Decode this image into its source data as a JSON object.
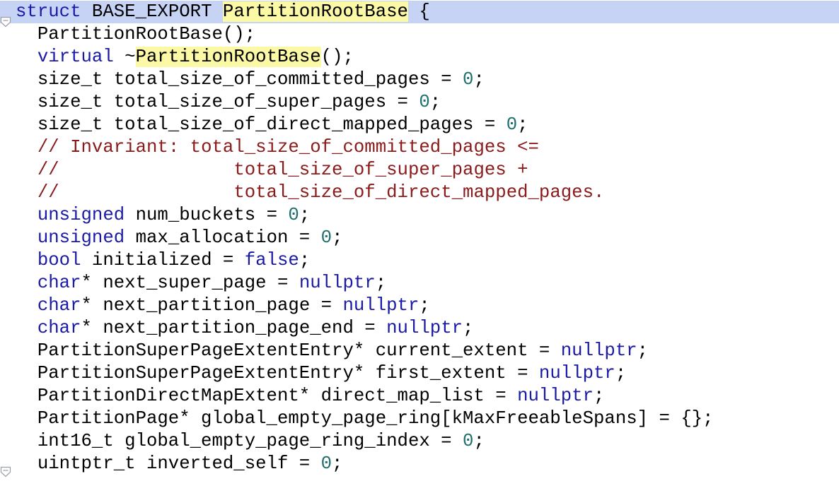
{
  "editor": {
    "colors": {
      "keyword": "#1a1aa6",
      "number": "#1f6f6f",
      "comment": "#8b1a1a",
      "identifier_highlight": "#fbf8a6",
      "current_line": "#c6d3f5"
    },
    "fold_markers": [
      "fold-open-icon",
      "fold-close-icon"
    ],
    "lines": [
      [
        {
          "t": "kw",
          "v": "struct"
        },
        {
          "t": "",
          "v": " BASE_EXPORT "
        },
        {
          "t": "hl",
          "v": "PartitionRootBase"
        },
        {
          "t": "",
          "v": " {"
        }
      ],
      [
        {
          "t": "",
          "v": "  PartitionRootBase();"
        }
      ],
      [
        {
          "t": "",
          "v": "  "
        },
        {
          "t": "kw",
          "v": "virtual"
        },
        {
          "t": "",
          "v": " ~"
        },
        {
          "t": "hl",
          "v": "PartitionRootBase"
        },
        {
          "t": "",
          "v": "();"
        }
      ],
      [
        {
          "t": "",
          "v": "  size_t total_size_of_committed_pages = "
        },
        {
          "t": "num",
          "v": "0"
        },
        {
          "t": "",
          "v": ";"
        }
      ],
      [
        {
          "t": "",
          "v": "  size_t total_size_of_super_pages = "
        },
        {
          "t": "num",
          "v": "0"
        },
        {
          "t": "",
          "v": ";"
        }
      ],
      [
        {
          "t": "",
          "v": "  size_t total_size_of_direct_mapped_pages = "
        },
        {
          "t": "num",
          "v": "0"
        },
        {
          "t": "",
          "v": ";"
        }
      ],
      [
        {
          "t": "",
          "v": "  "
        },
        {
          "t": "cmt",
          "v": "// Invariant: total_size_of_committed_pages <="
        }
      ],
      [
        {
          "t": "",
          "v": "  "
        },
        {
          "t": "cmt",
          "v": "//                total_size_of_super_pages +"
        }
      ],
      [
        {
          "t": "",
          "v": "  "
        },
        {
          "t": "cmt",
          "v": "//                total_size_of_direct_mapped_pages."
        }
      ],
      [
        {
          "t": "",
          "v": "  "
        },
        {
          "t": "kw",
          "v": "unsigned"
        },
        {
          "t": "",
          "v": " num_buckets = "
        },
        {
          "t": "num",
          "v": "0"
        },
        {
          "t": "",
          "v": ";"
        }
      ],
      [
        {
          "t": "",
          "v": "  "
        },
        {
          "t": "kw",
          "v": "unsigned"
        },
        {
          "t": "",
          "v": " max_allocation = "
        },
        {
          "t": "num",
          "v": "0"
        },
        {
          "t": "",
          "v": ";"
        }
      ],
      [
        {
          "t": "",
          "v": "  "
        },
        {
          "t": "kw",
          "v": "bool"
        },
        {
          "t": "",
          "v": " initialized = "
        },
        {
          "t": "kw",
          "v": "false"
        },
        {
          "t": "",
          "v": ";"
        }
      ],
      [
        {
          "t": "",
          "v": "  "
        },
        {
          "t": "kw",
          "v": "char"
        },
        {
          "t": "",
          "v": "* next_super_page = "
        },
        {
          "t": "kw",
          "v": "nullptr"
        },
        {
          "t": "",
          "v": ";"
        }
      ],
      [
        {
          "t": "",
          "v": "  "
        },
        {
          "t": "kw",
          "v": "char"
        },
        {
          "t": "",
          "v": "* next_partition_page = "
        },
        {
          "t": "kw",
          "v": "nullptr"
        },
        {
          "t": "",
          "v": ";"
        }
      ],
      [
        {
          "t": "",
          "v": "  "
        },
        {
          "t": "kw",
          "v": "char"
        },
        {
          "t": "",
          "v": "* next_partition_page_end = "
        },
        {
          "t": "kw",
          "v": "nullptr"
        },
        {
          "t": "",
          "v": ";"
        }
      ],
      [
        {
          "t": "",
          "v": "  PartitionSuperPageExtentEntry* current_extent = "
        },
        {
          "t": "kw",
          "v": "nullptr"
        },
        {
          "t": "",
          "v": ";"
        }
      ],
      [
        {
          "t": "",
          "v": "  PartitionSuperPageExtentEntry* first_extent = "
        },
        {
          "t": "kw",
          "v": "nullptr"
        },
        {
          "t": "",
          "v": ";"
        }
      ],
      [
        {
          "t": "",
          "v": "  PartitionDirectMapExtent* direct_map_list = "
        },
        {
          "t": "kw",
          "v": "nullptr"
        },
        {
          "t": "",
          "v": ";"
        }
      ],
      [
        {
          "t": "",
          "v": "  PartitionPage* global_empty_page_ring[kMaxFreeableSpans] = {};"
        }
      ],
      [
        {
          "t": "",
          "v": "  int16_t global_empty_page_ring_index = "
        },
        {
          "t": "num",
          "v": "0"
        },
        {
          "t": "",
          "v": ";"
        }
      ],
      [
        {
          "t": "",
          "v": "  uintptr_t inverted_self = "
        },
        {
          "t": "num",
          "v": "0"
        },
        {
          "t": "",
          "v": ";"
        }
      ]
    ]
  }
}
